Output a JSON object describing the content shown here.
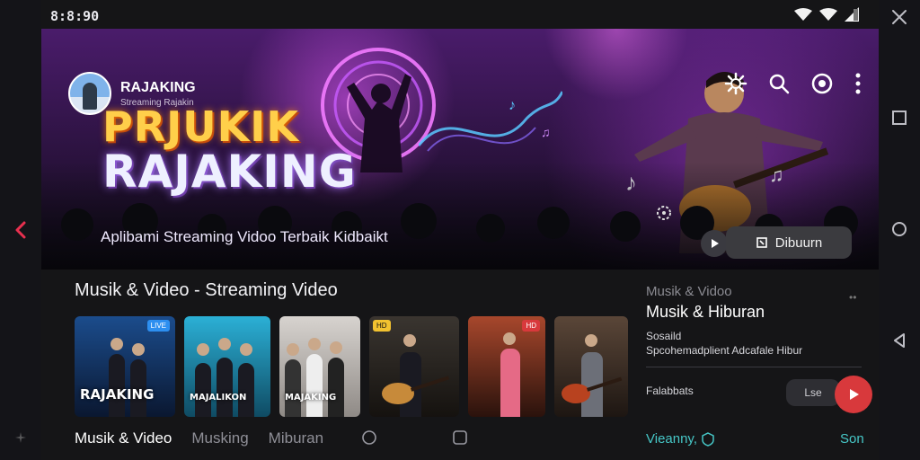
{
  "status_bar": {
    "time": "8:8:90"
  },
  "channel": {
    "name": "RAJAKING",
    "subtitle": "Streaming Rajakin"
  },
  "hero": {
    "logo_line1": "PRJUKIK",
    "logo_line2": "RAJAKING",
    "tagline": "Aplibami Streaming Vidoo Terbaik Kidbaikt",
    "follow_label": "Dibuurn"
  },
  "section": {
    "title": "Musik & Video - Streaming Video"
  },
  "thumbnails": [
    {
      "caption": "RAJAKING",
      "badge": "LIVE",
      "bg": "#0f2a52"
    },
    {
      "caption": "MAJALIKON",
      "badge": "",
      "bg": "#1d84a6"
    },
    {
      "caption": "MAJAKING",
      "badge": "",
      "bg": "#c7c3bf"
    },
    {
      "caption": "",
      "badge": "HD",
      "bg": "#2a2a2a"
    },
    {
      "caption": "",
      "badge": "HD",
      "bg": "#6a2a1f"
    },
    {
      "caption": "",
      "badge": "",
      "bg": "#3b2b22"
    }
  ],
  "bottom_tabs": [
    {
      "label": "Musik & Video",
      "active": true
    },
    {
      "label": "Musking",
      "active": false
    },
    {
      "label": "Miburan",
      "active": false
    }
  ],
  "panel": {
    "meta": "Musik & Vidoo",
    "title": "Musik & Hiburan",
    "line1": "Sosaild",
    "line2": "Spcohemadplient Adcafale Hibur",
    "stat_label": "Falabbats",
    "tag": "Lse",
    "views_left": "Vieanny,",
    "views_right": "Son"
  },
  "colors": {
    "accent": "#d8393c",
    "teal": "#46c7c7",
    "back_arrow": "#e8304f"
  }
}
